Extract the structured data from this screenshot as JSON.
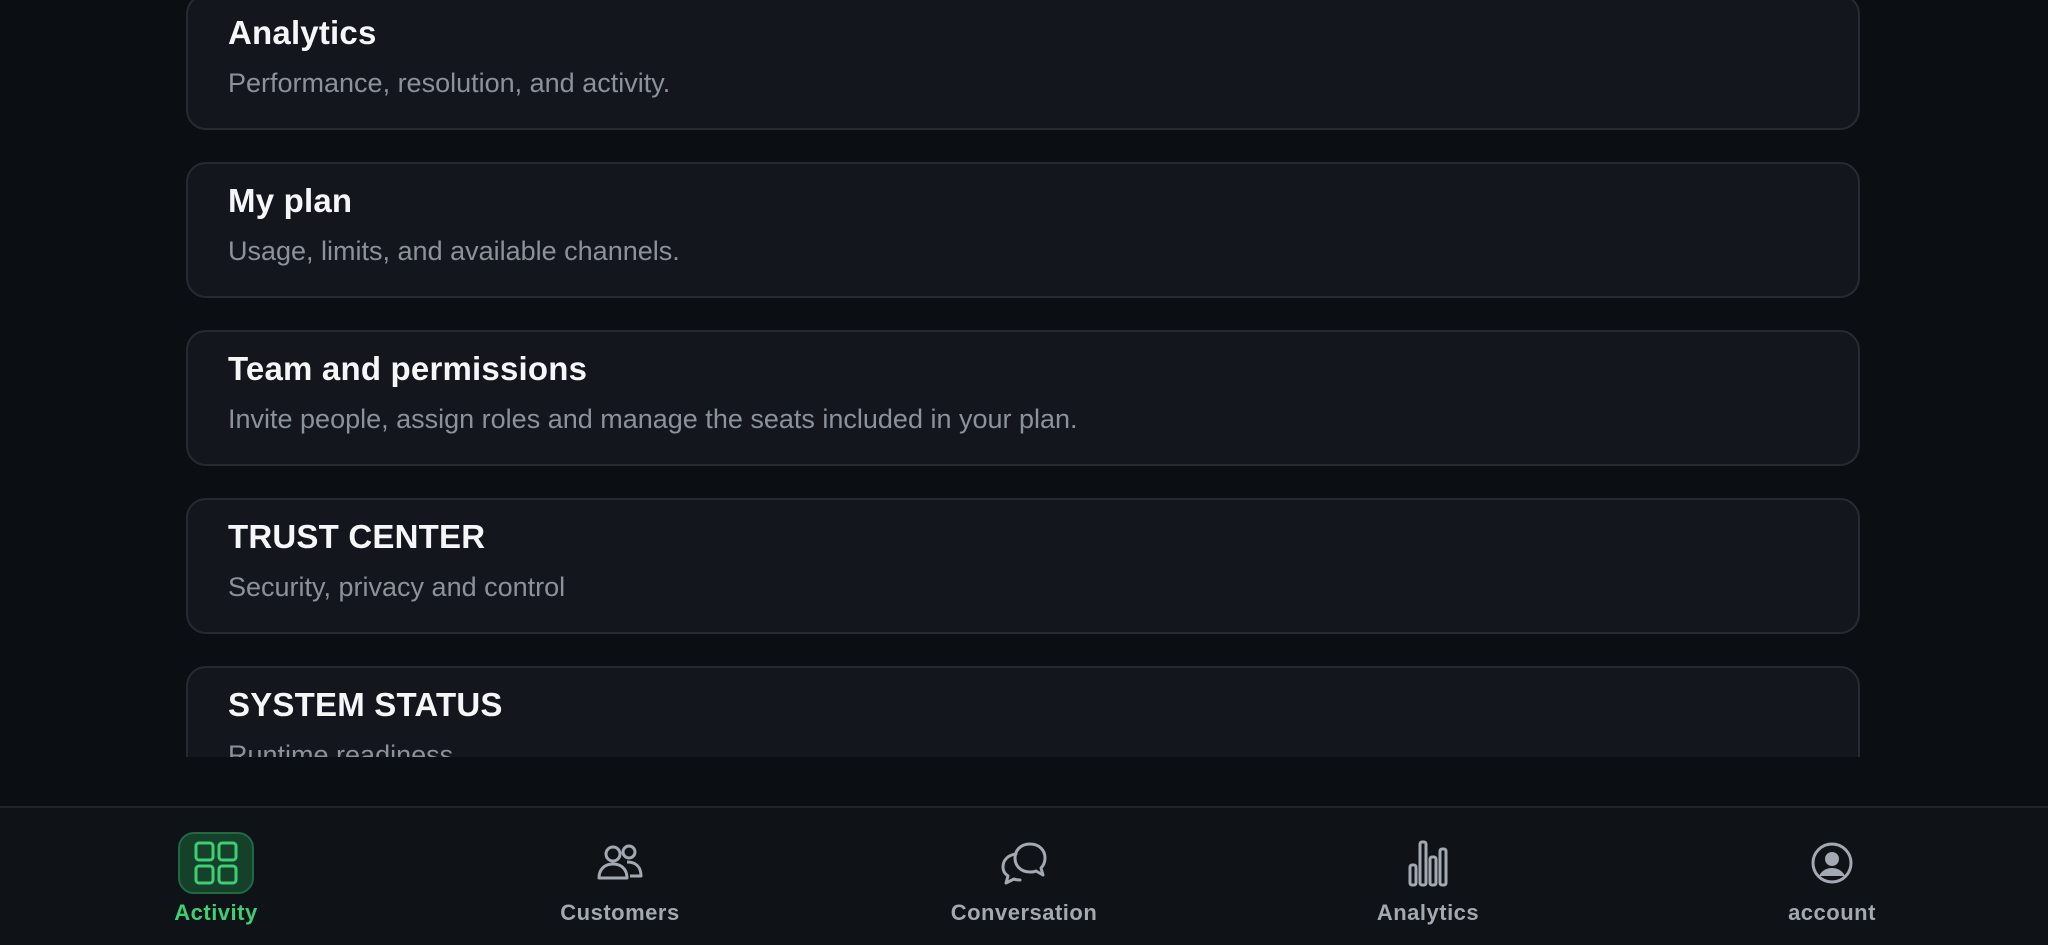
{
  "cards": [
    {
      "title": "Analytics",
      "description": "Performance, resolution, and activity."
    },
    {
      "title": "My plan",
      "description": "Usage, limits, and available channels."
    },
    {
      "title": "Team and permissions",
      "description": "Invite people, assign roles and manage the seats included in your plan."
    },
    {
      "title": "TRUST CENTER",
      "description": "Security, privacy and control"
    },
    {
      "title": "SYSTEM STATUS",
      "description": "Runtime readiness"
    }
  ],
  "nav": {
    "active": "activity",
    "items": [
      {
        "label": "Activity",
        "icon": "grid-icon"
      },
      {
        "label": "Customers",
        "icon": "users-icon"
      },
      {
        "label": "Conversation",
        "icon": "chat-bubbles-icon"
      },
      {
        "label": "Analytics",
        "icon": "bar-chart-icon"
      },
      {
        "label": "account",
        "icon": "user-circle-icon"
      }
    ]
  },
  "colors": {
    "background": "#0b0e12",
    "card": "#13171d",
    "accent": "#3ecf74",
    "muted": "#8b929c"
  }
}
